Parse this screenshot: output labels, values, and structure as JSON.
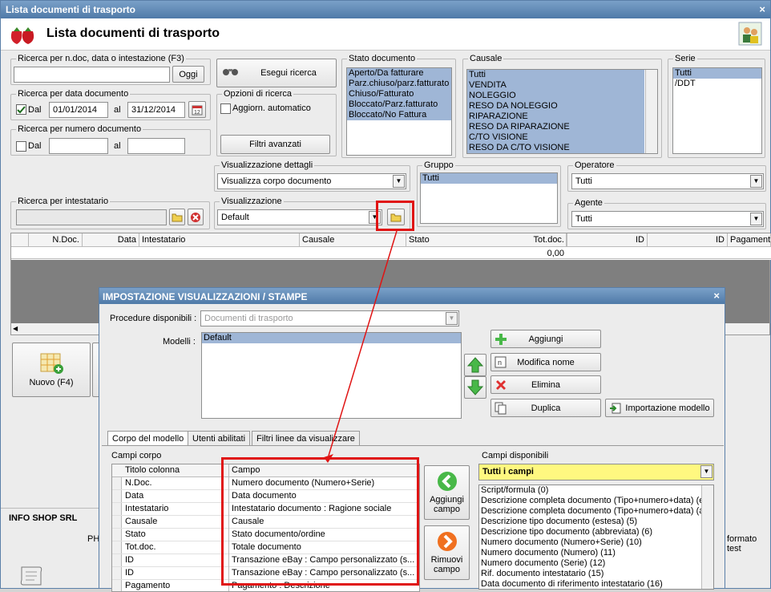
{
  "window": {
    "title": "Lista documenti di trasporto",
    "close": "×"
  },
  "header": {
    "title": "Lista documenti di trasporto"
  },
  "search_ndoc": {
    "legend": "Ricerca per n.doc, data o intestazione (F3)",
    "value": "",
    "button": "Oggi"
  },
  "search_date": {
    "legend": "Ricerca per data documento",
    "check_label": "Dal",
    "from": "01/01/2014",
    "to_label": "al",
    "to": "31/12/2014",
    "checked": true
  },
  "search_num": {
    "legend": "Ricerca per numero documento",
    "check_label": "Dal",
    "to_label": "al"
  },
  "execute_button": "Esegui ricerca",
  "options": {
    "legend": "Opzioni di ricerca",
    "auto_label": "Aggiorn. automatico",
    "advanced": "Filtri avanzati"
  },
  "stato": {
    "legend": "Stato documento",
    "items": [
      "Aperto/Da fatturare",
      "Parz.chiuso/parz.fatturato",
      "Chiuso/Fatturato",
      "Bloccato/Parz.fatturato",
      "Bloccato/No Fattura"
    ]
  },
  "causale": {
    "legend": "Causale",
    "items": [
      "Tutti",
      "VENDITA",
      "NOLEGGIO",
      "RESO DA NOLEGGIO",
      "RIPARAZIONE",
      "RESO DA RIPARAZIONE",
      "C/TO VISIONE",
      "RESO DA C/TO VISIONE"
    ]
  },
  "serie": {
    "legend": "Serie",
    "items": [
      "Tutti",
      "/DDT"
    ]
  },
  "vis_dettagli": {
    "legend": "Visualizzazione dettagli",
    "value": "Visualizza corpo documento"
  },
  "gruppo": {
    "legend": "Gruppo",
    "items": [
      "Tutti"
    ]
  },
  "operatore": {
    "legend": "Operatore",
    "value": "Tutti"
  },
  "intestatario": {
    "legend": "Ricerca per intestatario"
  },
  "visualizzazione": {
    "legend": "Visualizzazione",
    "value": "Default"
  },
  "agente": {
    "legend": "Agente",
    "value": "Tutti"
  },
  "grid": {
    "headers": [
      "N.Doc.",
      "Data",
      "Intestatario",
      "Causale",
      "Stato",
      "Tot.doc.",
      "ID",
      "ID",
      "Pagamento"
    ],
    "total": "0,00"
  },
  "new_button": "Nuovo (F4)",
  "status_company": "INFO SHOP SRL",
  "footer_left": "PH",
  "footer_right": "formato test",
  "dialog": {
    "title": "IMPOSTAZIONE VISUALIZZAZIONI / STAMPE",
    "close": "×",
    "procedure_label": "Procedure disponibili :",
    "procedure_value": "Documenti di trasporto",
    "models_label": "Modelli :",
    "models": [
      "Default"
    ],
    "btn_add": "Aggiungi",
    "btn_rename": "Modifica nome",
    "btn_delete": "Elimina",
    "btn_dup": "Duplica",
    "btn_import": "Importazione modello",
    "tabs": [
      "Corpo del modello",
      "Utenti abilitati",
      "Filtri linee da visualizzare"
    ],
    "campi_corpo": "Campi corpo",
    "col_title": "Titolo colonna",
    "col_field": "Campo",
    "rows": [
      {
        "t": "N.Doc.",
        "c": "Numero documento (Numero+Serie)"
      },
      {
        "t": "Data",
        "c": "Data documento"
      },
      {
        "t": "Intestatario",
        "c": "Intestatario documento : Ragione sociale"
      },
      {
        "t": "Causale",
        "c": "Causale"
      },
      {
        "t": "Stato",
        "c": "Stato documento/ordine"
      },
      {
        "t": "Tot.doc.",
        "c": "Totale documento"
      },
      {
        "t": "ID",
        "c": "Transazione eBay : Campo personalizzato (s..."
      },
      {
        "t": "ID",
        "c": "Transazione eBay : Campo personalizzato (s..."
      },
      {
        "t": "Pagamento",
        "c": "Pagamento : Descrizione"
      }
    ],
    "add_field": "Aggiungi campo",
    "remove_field": "Rimuovi campo",
    "campi_disp": "Campi disponibili",
    "campi_filter": "Tutti i campi",
    "available": [
      "Script/formula (0)",
      "Descrizione completa documento (Tipo+numero+data) (e",
      "Descrizione completa documento (Tipo+numero+data) (a",
      "Descrizione tipo documento (estesa) (5)",
      "Descrizione tipo documento (abbreviata) (6)",
      "Numero documento (Numero+Serie) (10)",
      "Numero documento (Numero) (11)",
      "Numero documento (Serie) (12)",
      "Rif. documento intestatario (15)",
      "Data documento di riferimento intestatario (16)"
    ]
  },
  "colors": {
    "accent": "#e01414",
    "selection": "#9fb6d6",
    "title": "#4f7aa8"
  }
}
